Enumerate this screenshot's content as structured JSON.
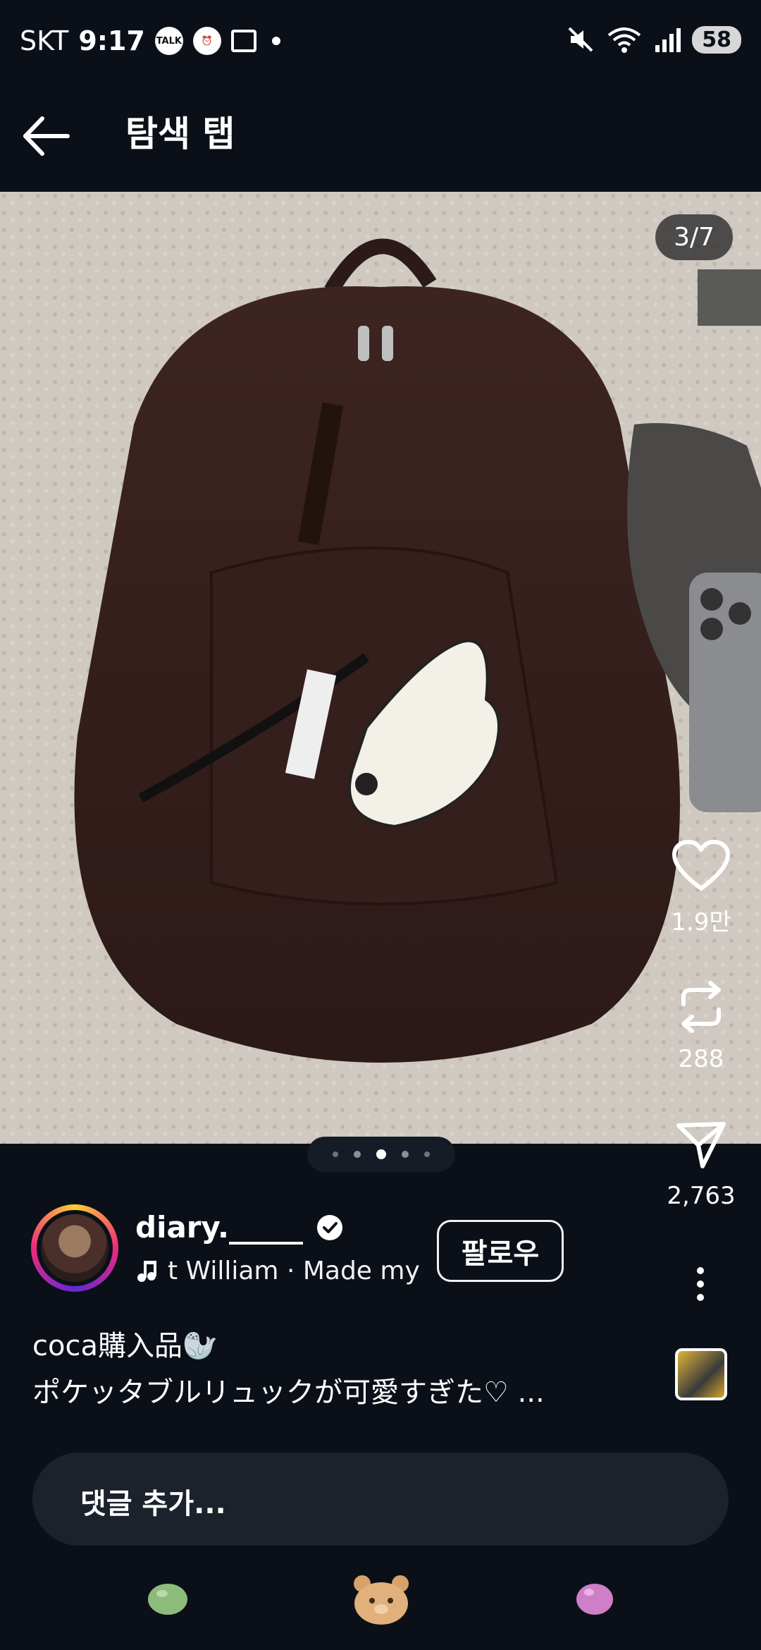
{
  "status_bar": {
    "carrier": "SKT",
    "time": "9:17",
    "battery": "58",
    "signal_label": "5"
  },
  "header": {
    "title": "탐색 탭"
  },
  "post": {
    "counter": "3/7",
    "carousel": {
      "total": 5,
      "active_index": 2
    },
    "likes": "1.9만",
    "reposts": "288",
    "shares": "2,763",
    "author": {
      "username": "diary._____",
      "music": "t William · Made my",
      "follow_label": "팔로우"
    },
    "caption_line1": "coca購入品🦭",
    "caption_line2": "ポケッタブルリュックが可愛すぎた♡ ..."
  },
  "comment": {
    "placeholder": "댓글 추가..."
  },
  "icons": {
    "back": "arrow-left-icon",
    "like": "heart-icon",
    "repost": "repost-icon",
    "share": "send-icon",
    "more": "more-vertical-icon",
    "verified": "verified-badge-icon",
    "music": "music-note-icon"
  },
  "colors": {
    "background": "#0b1018",
    "comment_bar": "#1c222c",
    "backpack": "#3b2220",
    "carpet": "#cfc9c2"
  }
}
